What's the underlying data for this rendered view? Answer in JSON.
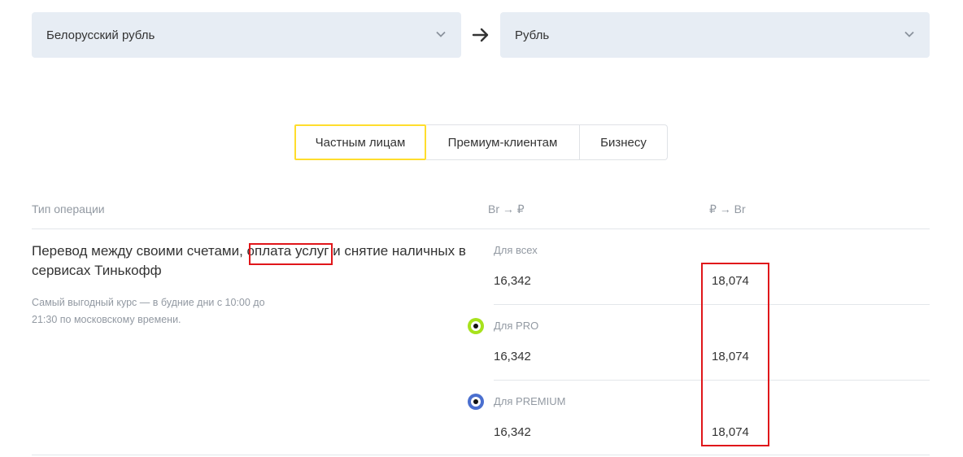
{
  "converter": {
    "from_currency": "Белорусский рубль",
    "to_currency": "Рубль"
  },
  "tabs": [
    {
      "label": "Частным лицам",
      "active": true
    },
    {
      "label": "Премиум-клиентам",
      "active": false
    },
    {
      "label": "Бизнесу",
      "active": false
    }
  ],
  "table": {
    "headers": {
      "operation_type": "Тип операции",
      "buy": "Br → ₽",
      "sell": "₽ → Br"
    },
    "operation": {
      "title_part1": "Перевод между своими счетами, ",
      "title_highlight": "оплата услуг",
      "title_part2": " и снятие наличных в сервисах Тинькофф",
      "note": "Самый выгодный курс — в будние дни с 10:00 до 21:30 по московскому времени."
    },
    "groups": [
      {
        "label": "Для всех",
        "buy": "16,342",
        "sell": "18,074"
      },
      {
        "label": "Для PRO",
        "buy": "16,342",
        "sell": "18,074",
        "badge_color": "#a7e21c"
      },
      {
        "label": "Для PREMIUM",
        "buy": "16,342",
        "sell": "18,074",
        "badge_color": "#4a6fcf"
      }
    ]
  },
  "colors": {
    "select_bg": "#e7edf4",
    "active_tab_border": "#ffdd2d",
    "annotation_red": "#e0161a"
  }
}
